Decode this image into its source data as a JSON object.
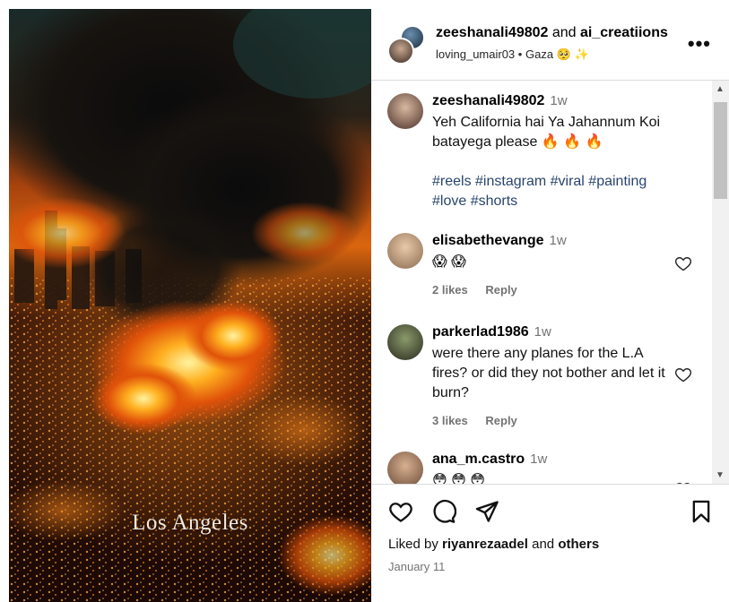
{
  "media": {
    "caption": "Los Angeles"
  },
  "header": {
    "user1": "zeeshanali49802",
    "and_label": "and",
    "user2": "ai_creatiions",
    "sub_user": "loving_umair03",
    "separator": "•",
    "location": "Gaza 🥺 ✨",
    "more_label": "•••"
  },
  "post": {
    "username": "zeeshanali49802",
    "time": "1w",
    "text": "Yeh California hai Ya Jahannum Koi batayega please 🔥 🔥 🔥",
    "hashtags": "#reels #instagram #viral #painting #love #shorts"
  },
  "comments": [
    {
      "username": "elisabethevange",
      "time": "1w",
      "text": "😱 😱",
      "likes": "2 likes",
      "reply": "Reply"
    },
    {
      "username": "parkerlad1986",
      "time": "1w",
      "text": "were there any planes for the L.A fires? or did they not bother and let it burn?",
      "likes": "3 likes",
      "reply": "Reply"
    },
    {
      "username": "ana_m.castro",
      "time": "1w",
      "text": "😳 😳 😳"
    }
  ],
  "footer": {
    "liked_prefix": "Liked by",
    "liked_user": "riyanrezaadel",
    "liked_and": "and",
    "liked_others": "others",
    "date": "January 11"
  },
  "colors": {
    "hashtag": "#29456e",
    "muted": "#737373",
    "divider": "#dbdbdb"
  },
  "icons": [
    "heart-icon",
    "comment-icon",
    "share-icon",
    "bookmark-icon",
    "more-icon"
  ]
}
